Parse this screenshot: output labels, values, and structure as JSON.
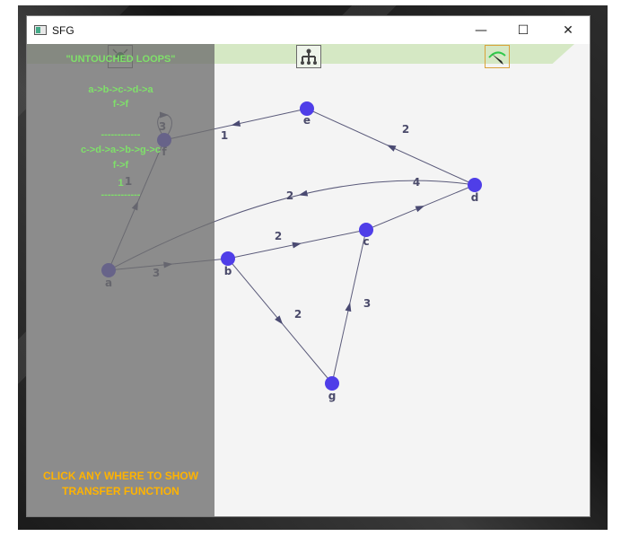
{
  "window": {
    "title": "SFG"
  },
  "controls": {
    "minimize": "—",
    "maximize": "☐",
    "close": "✕"
  },
  "toolbar": {
    "buttons": [
      "add-node-tool",
      "tree-layout-tool",
      "pen-edit-tool"
    ]
  },
  "graph": {
    "nodes": [
      {
        "id": "e",
        "label": "e"
      },
      {
        "id": "d",
        "label": "d"
      },
      {
        "id": "c",
        "label": "c"
      },
      {
        "id": "b",
        "label": "b"
      },
      {
        "id": "a",
        "label": "a"
      },
      {
        "id": "f",
        "label": "f"
      },
      {
        "id": "g",
        "label": "g"
      }
    ],
    "edges": [
      {
        "from": "e",
        "to": "f",
        "gain": "1"
      },
      {
        "from": "d",
        "to": "e",
        "gain": "2"
      },
      {
        "from": "d",
        "to": "a",
        "gain": "2"
      },
      {
        "from": "c",
        "to": "d",
        "gain": "4"
      },
      {
        "from": "b",
        "to": "c",
        "gain": "2"
      },
      {
        "from": "a",
        "to": "b",
        "gain": "3"
      },
      {
        "from": "a",
        "to": "f",
        "gain": "1"
      },
      {
        "from": "f",
        "to": "f",
        "gain": "3"
      },
      {
        "from": "b",
        "to": "g",
        "gain": "2"
      },
      {
        "from": "g",
        "to": "c",
        "gain": "3"
      }
    ]
  },
  "panel": {
    "heading": "\"UNTOUCHED LOOPS\"",
    "lines": [
      "a->b->c->d->a",
      "f->f",
      "------------",
      "c->d->a->b->g->c",
      "f->f",
      "1",
      "------------"
    ],
    "footer_line1": "CLICK ANY WHERE TO SHOW",
    "footer_line2": "TRANSFER FUNCTION"
  },
  "colors": {
    "node": "#4f3ee8",
    "edge": "#5a5a7a",
    "panel_text": "#7fe06a",
    "footer_text": "#ffb300"
  }
}
